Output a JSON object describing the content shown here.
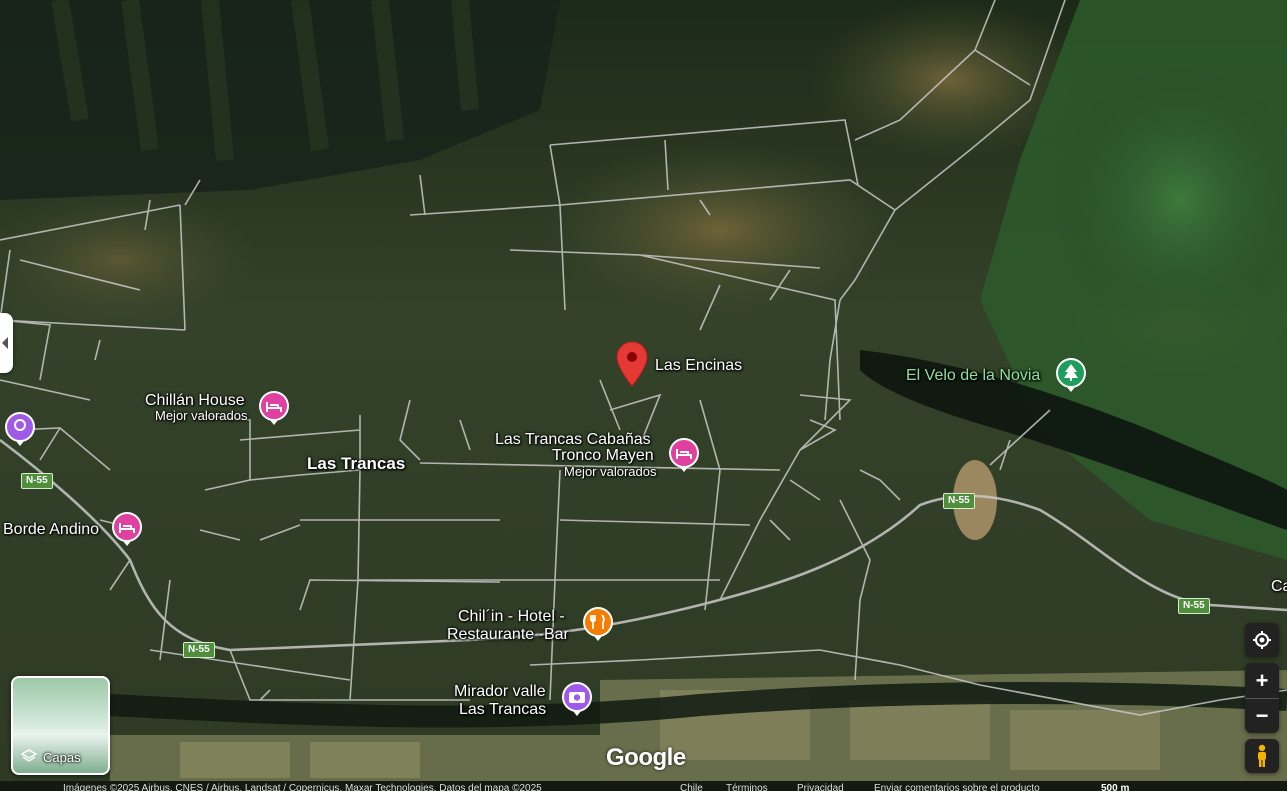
{
  "map": {
    "view_mode": "satellite",
    "colors": {
      "road": "#c9c9c9",
      "forest_dark": "#1f2f1a",
      "forest_mid": "#3a4a2a",
      "clearing": "#6b6440",
      "bright_green": "#2f6a32",
      "pin_red": "#e53935",
      "hotel_pink": "#e040a0",
      "restaurant_orange": "#f57c00",
      "photo_purple": "#a05ae8",
      "park_green": "#1e9e5a"
    }
  },
  "places": {
    "selected": {
      "name": "Las Encinas",
      "icon": "red-pin-icon"
    },
    "chillan_house": {
      "name": "Chillán House",
      "subtitle": "Mejor valorados",
      "icon": "hotel-icon"
    },
    "las_trancas_cabanas": {
      "line1": "Las Trancas Cabañas",
      "line2": "Tronco Mayen",
      "subtitle": "Mejor valorados",
      "icon": "hotel-icon"
    },
    "borde_andino": {
      "name": "Borde Andino",
      "icon": "hotel-icon"
    },
    "chilin": {
      "line1": "Chil´in - Hotel -",
      "line2": "Restaurante -Bar",
      "icon": "restaurant-icon"
    },
    "mirador": {
      "line1": "Mirador valle",
      "line2": "Las Trancas",
      "icon": "camera-icon"
    },
    "velo_novia": {
      "name": "El Velo de la Novia",
      "icon": "park-tree-icon"
    },
    "edge_ca": {
      "name": "Ca"
    },
    "edge_left": {
      "icon": "photo-spot-icon"
    }
  },
  "town": {
    "name": "Las Trancas"
  },
  "routes": [
    {
      "label": "N-55"
    },
    {
      "label": "N-55"
    },
    {
      "label": "N-55"
    },
    {
      "label": "N-55"
    }
  ],
  "controls": {
    "layers_label": "Capas",
    "my_location": "my-location-icon",
    "zoom_in": "+",
    "zoom_out": "−",
    "pegman": "pegman-icon"
  },
  "branding": {
    "logo": "Google"
  },
  "footer": {
    "attribution": "Imágenes ©2025 Airbus, CNES / Airbus, Landsat / Copernicus, Maxar Technologies, Datos del mapa ©2025",
    "country": "Chile",
    "terms": "Términos",
    "privacy": "Privacidad",
    "feedback": "Enviar comentarios sobre el producto",
    "scale": "500 m"
  }
}
